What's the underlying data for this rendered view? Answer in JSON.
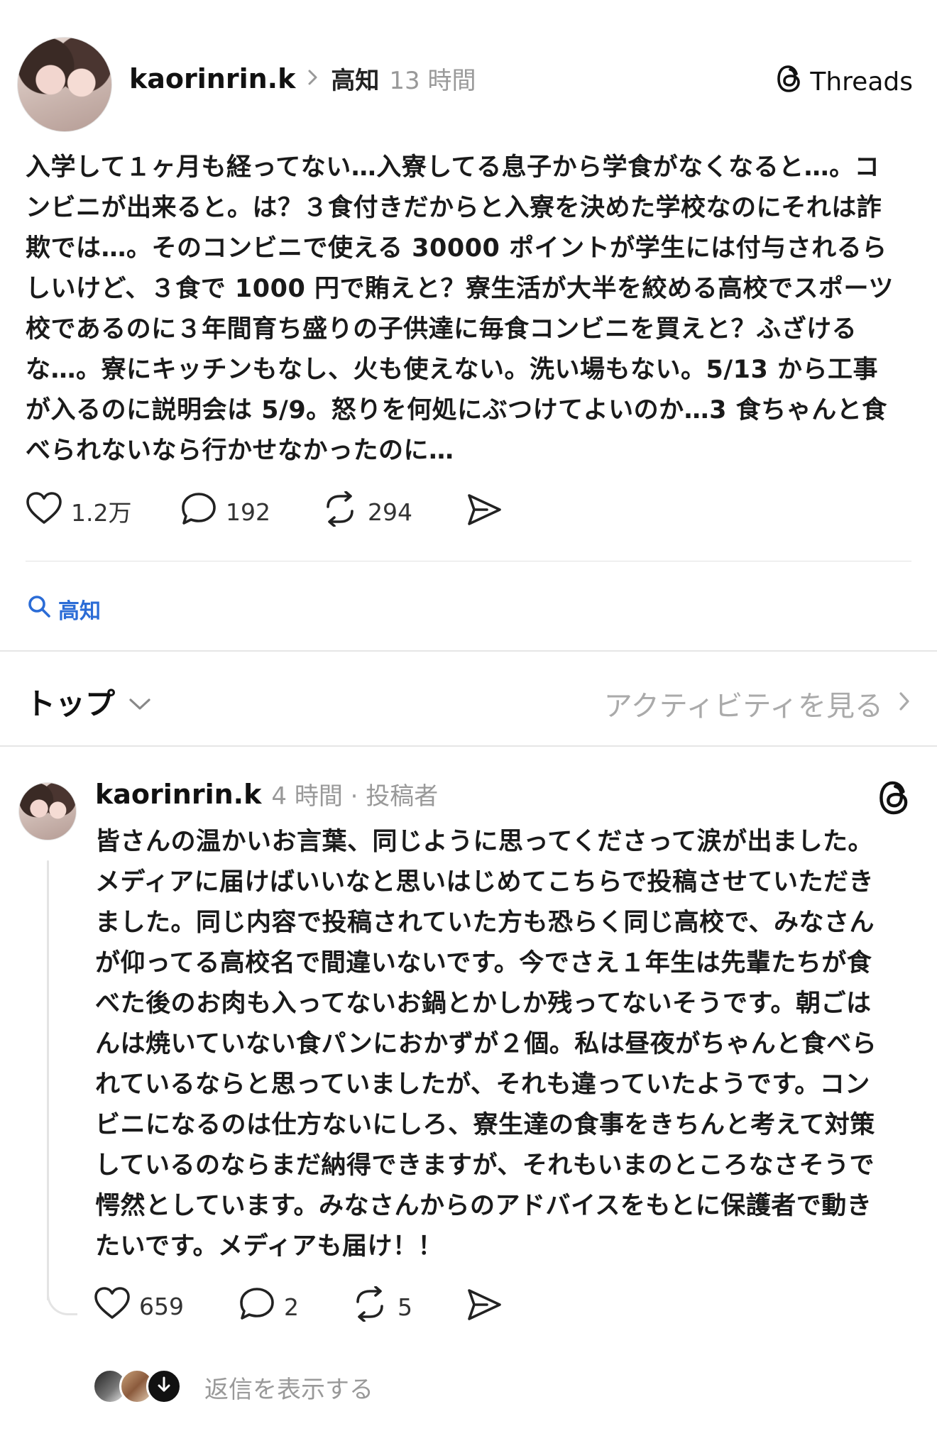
{
  "post": {
    "username": "kaorinrin.k",
    "location": "高知",
    "time": "13 時間",
    "brand": "Threads",
    "text_lines": [
      "入学して１ヶ月も経ってない…入寮してる息子から学食がなくなると…。コ",
      "ンビニが出来ると。は？３食付きだからと入寮を決めた学校なのにそれは詐",
      "欺では…。そのコンビニで使える 30000 ポイントが学生には付与されるら",
      "しいけど、３食で 1000 円で賄えと？寮生活が大半を絞める高校でスポーツ",
      "校であるのに３年間育ち盛りの子供達に毎食コンビニを買えと？ふざける",
      "な…。寮にキッチンもなし、火も使えない。洗い場もない。5/13 から工事",
      "が入るのに説明会は 5/9。怒りを何処にぶつけてよいのか…3 食ちゃんと食",
      "べられないなら行かせなかったのに…"
    ],
    "likes": "1.2万",
    "comments": "192",
    "reposts": "294"
  },
  "topic": {
    "label": "高知"
  },
  "sort": {
    "label": "トップ",
    "activity_link": "アクティビティを見る"
  },
  "reply": {
    "username": "kaorinrin.k",
    "time_author": "4 時間 · 投稿者",
    "text_lines": [
      "皆さんの温かいお言葉、同じように思ってくださって涙が出ました。",
      "メディアに届けばいいなと思いはじめてこちらで投稿させていただき",
      "ました。同じ内容で投稿されていた方も恐らく同じ高校で、みなさん",
      "が仰ってる高校名で間違いないです。今でさえ１年生は先輩たちが食",
      "べた後のお肉も入ってないお鍋とかしか残ってないそうです。朝ごは",
      "んは焼いていない食パンにおかずが２個。私は昼夜がちゃんと食べら",
      "れているならと思っていましたが、それも違っていたようです。コン",
      "ビニになるのは仕方ないにしろ、寮生達の食事をきちんと考えて対策",
      "しているのならまだ納得できますが、それもいまのところなさそうで",
      "愕然としています。みなさんからのアドバイスをもとに保護者で動き",
      "たいです。メディアも届け！！"
    ],
    "likes": "659",
    "comments": "2",
    "reposts": "5",
    "show_replies": "返信を表示する"
  },
  "icons": {
    "like": "heart-icon",
    "comment": "comment-bubble-icon",
    "repost": "repost-icon",
    "share": "send-icon",
    "threads": "threads-logo-icon",
    "search": "search-icon",
    "chevron_down": "chevron-down-icon",
    "chevron_right": "chevron-right-icon"
  },
  "colors": {
    "topic_blue": "#2b6cd6",
    "muted_text": "#999999"
  }
}
